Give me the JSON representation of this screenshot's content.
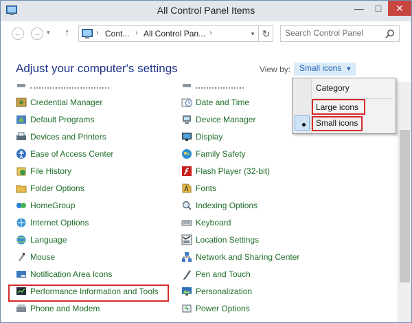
{
  "window": {
    "title": "All Control Panel Items",
    "minimize": "—",
    "maximize": "□",
    "close": "✕"
  },
  "nav": {
    "back": "←",
    "forward": "→",
    "history": "▾",
    "up": "↑",
    "breadcrumb": [
      "Cont...",
      "All Control Pan..."
    ],
    "crumb_sep": "›",
    "dropdown": "▾",
    "refresh": "↻"
  },
  "search": {
    "placeholder": "Search Control Panel"
  },
  "header": {
    "heading": "Adjust your computer's settings",
    "view_by_label": "View by:",
    "view_by_value": "Small icons",
    "arrow": "▼"
  },
  "view_menu": {
    "options": [
      "Category",
      "Large icons",
      "Small icons"
    ],
    "selected": "Small icons"
  },
  "items": {
    "left": [
      "Credential Manager",
      "Default Programs",
      "Devices and Printers",
      "Ease of Access Center",
      "File History",
      "Folder Options",
      "HomeGroup",
      "Internet Options",
      "Language",
      "Mouse",
      "Notification Area Icons",
      "Performance Information and Tools",
      "Phone and Modem"
    ],
    "right": [
      "Date and Time",
      "Device Manager",
      "Display",
      "Family Safety",
      "Flash Player (32-bit)",
      "Fonts",
      "Indexing Options",
      "Keyboard",
      "Location Settings",
      "Network and Sharing Center",
      "Pen and Touch",
      "Personalization",
      "Power Options"
    ]
  },
  "colors": {
    "link": "#1f6d28",
    "heading": "#1e3287",
    "accent": "#1a62b4",
    "highlight": "#d52a2a"
  }
}
